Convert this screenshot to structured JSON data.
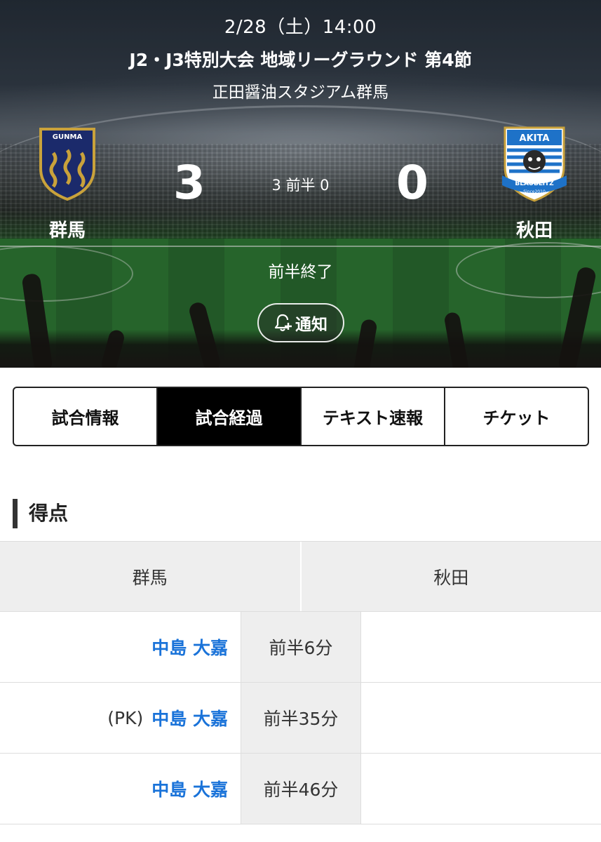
{
  "match": {
    "date": "2/28（土）14:00",
    "competition": "J2・J3特別大会 地域リーグラウンド 第4節",
    "venue": "正田醤油スタジアム群馬",
    "home": {
      "name": "群馬",
      "crest_text": "GUNMA",
      "score": "3"
    },
    "away": {
      "name": "秋田",
      "crest_top": "AKITA",
      "crest_bottom": "BLAUBLITZ",
      "crest_since": "Since2010",
      "score": "0"
    },
    "half_score": "3 前半 0",
    "status": "前半終了",
    "notify_label": "通知"
  },
  "tabs": [
    {
      "label": "試合情報",
      "active": false
    },
    {
      "label": "試合経過",
      "active": true
    },
    {
      "label": "テキスト速報",
      "active": false
    },
    {
      "label": "チケット",
      "active": false
    }
  ],
  "goals_section": {
    "title": "得点",
    "headers": {
      "home": "群馬",
      "away": "秋田"
    },
    "rows": [
      {
        "prefix": "",
        "scorer": "中島 大嘉",
        "time": "前半6分"
      },
      {
        "prefix": "(PK)",
        "scorer": "中島 大嘉",
        "time": "前半35分"
      },
      {
        "prefix": "",
        "scorer": "中島 大嘉",
        "time": "前半46分"
      }
    ]
  },
  "colors": {
    "accent_link": "#1a73d9",
    "tab_active_bg": "#000000",
    "table_header_bg": "#eeeeee",
    "gunma_navy": "#1b2a6b",
    "gunma_gold": "#c9a23b",
    "akita_blue": "#1e72c8"
  },
  "icons": {
    "notify": "bell-plus-icon"
  }
}
